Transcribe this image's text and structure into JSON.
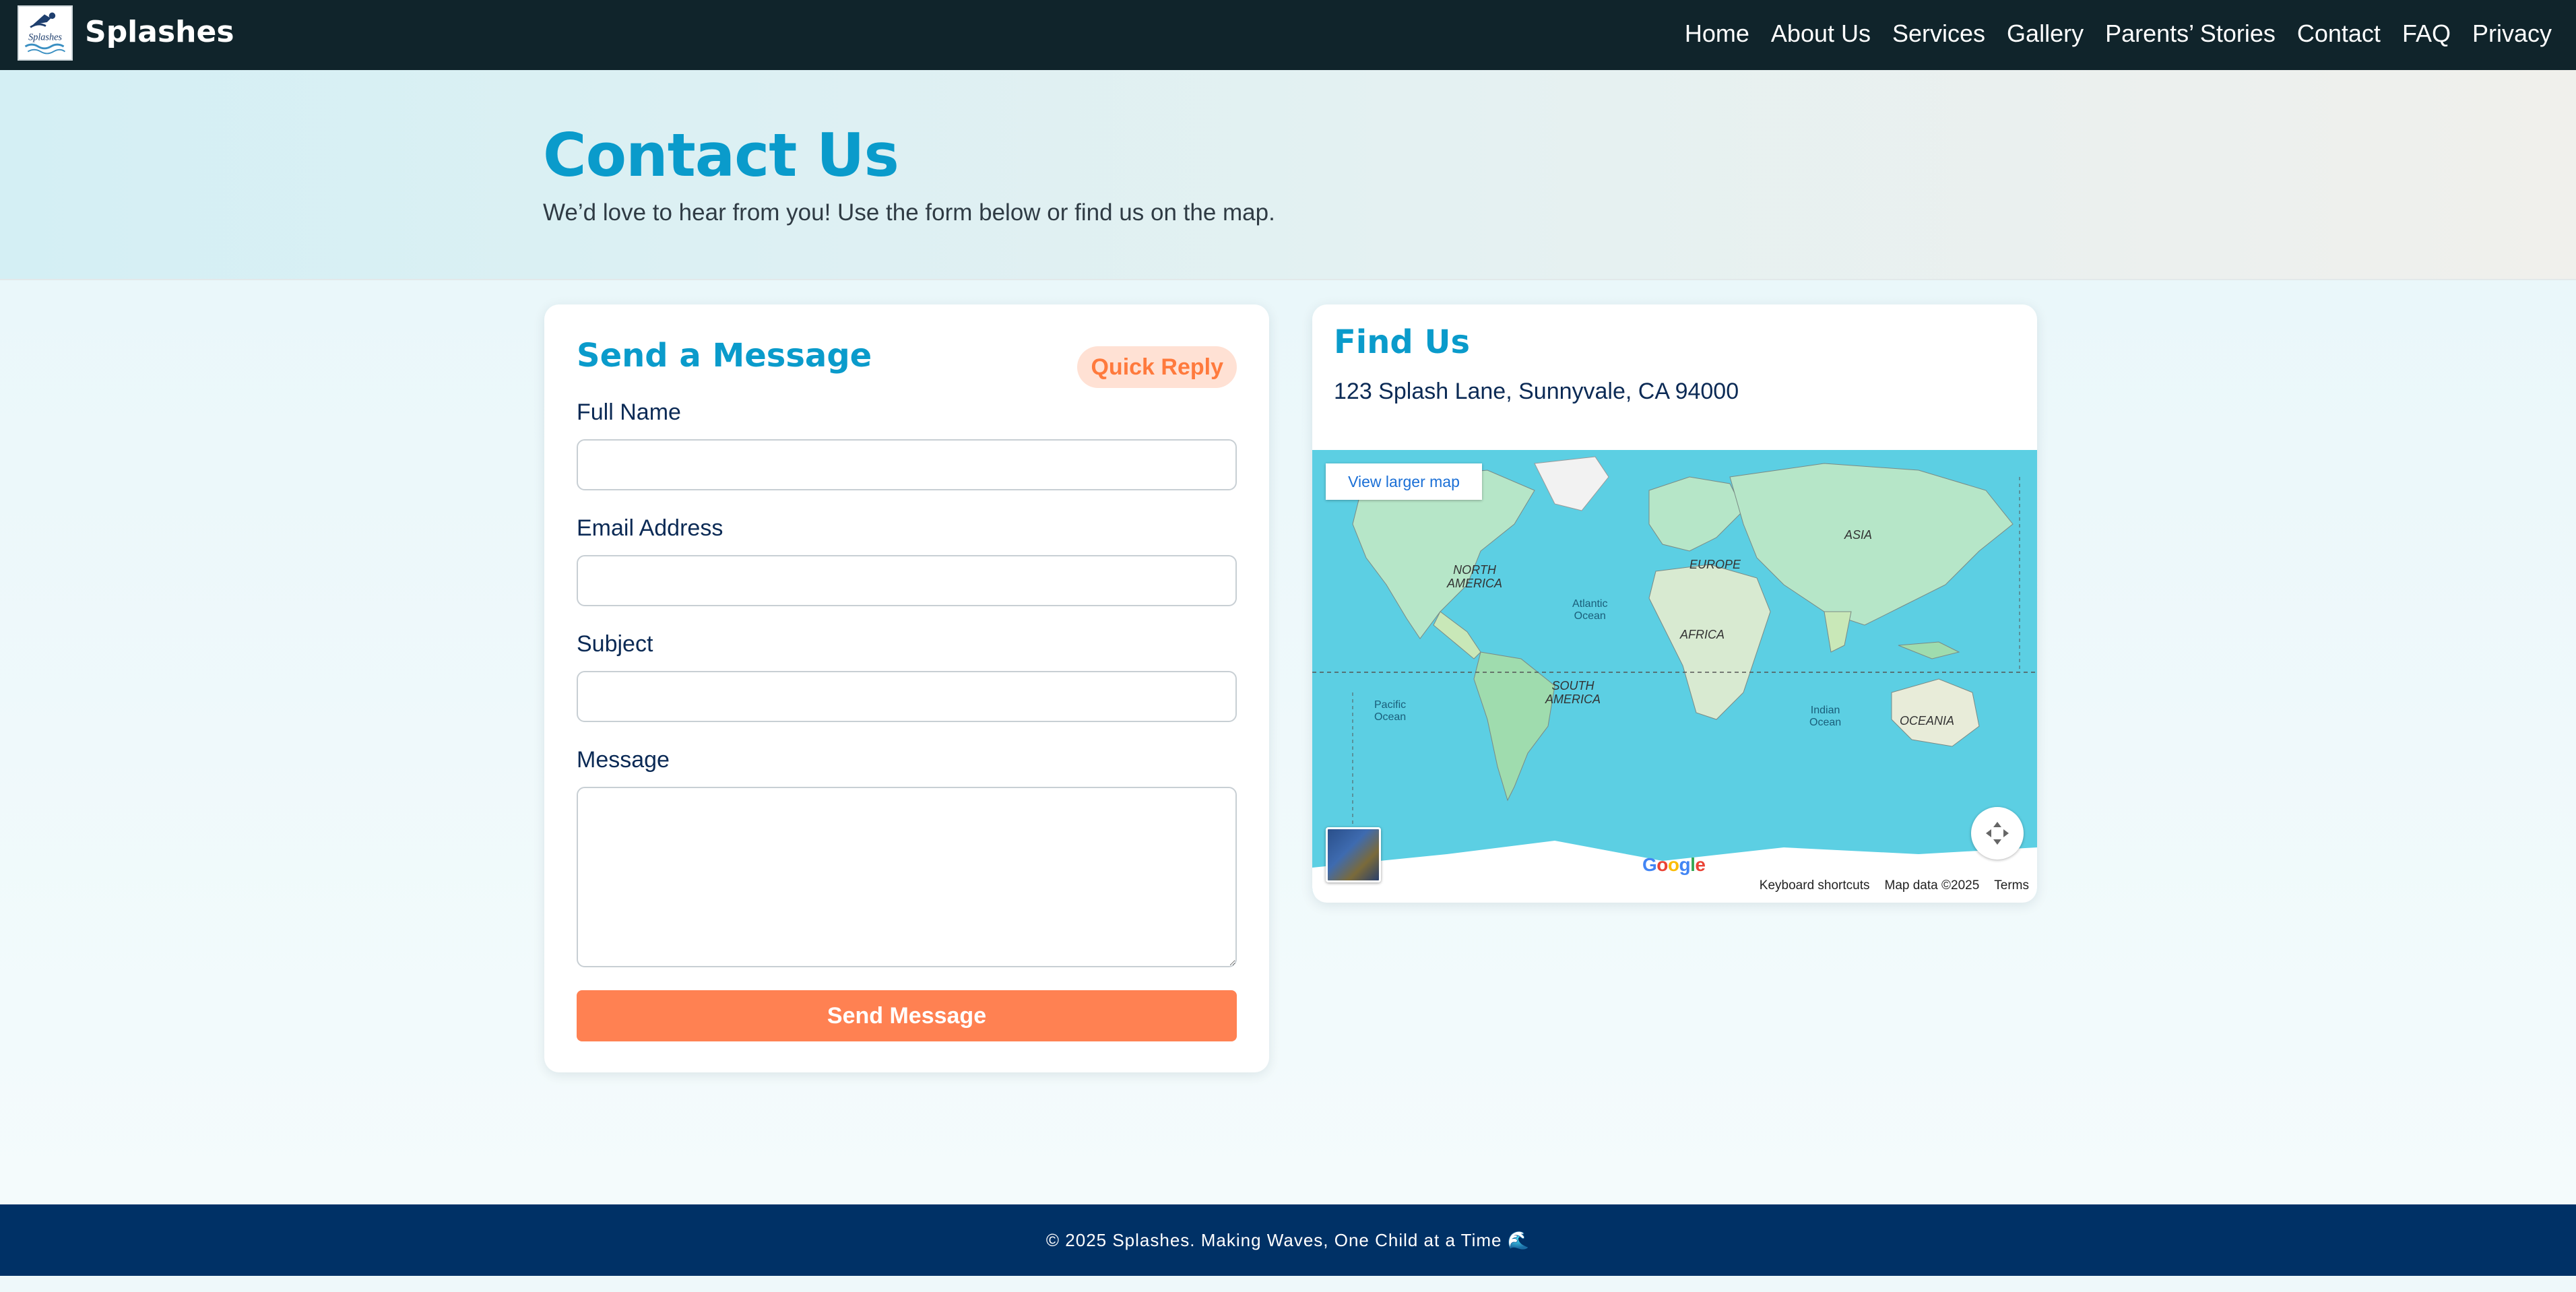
{
  "nav": {
    "brand": "Splashes",
    "logo_text": "Splashes",
    "links": [
      "Home",
      "About Us",
      "Services",
      "Gallery",
      "Parents’ Stories",
      "Contact",
      "FAQ",
      "Privacy"
    ]
  },
  "hero": {
    "title": "Contact Us",
    "subtitle": "We’d love to hear from you! Use the form below or find us on the map."
  },
  "form": {
    "title": "Send a Message",
    "badge": "Quick Reply",
    "fields": {
      "full_name": {
        "label": "Full Name",
        "value": ""
      },
      "email": {
        "label": "Email Address",
        "value": ""
      },
      "subject": {
        "label": "Subject",
        "value": ""
      },
      "message": {
        "label": "Message",
        "value": ""
      }
    },
    "submit_label": "Send Message"
  },
  "map_card": {
    "title": "Find Us",
    "address": "123 Splash Lane, Sunnyvale, CA 94000",
    "view_larger": "View larger map",
    "labels": {
      "north_america": "NORTH\nAMERICA",
      "south_america": "SOUTH\nAMERICA",
      "europe": "EUROPE",
      "asia": "ASIA",
      "africa": "AFRICA",
      "oceania": "OCEANIA",
      "atlantic": "Atlantic\nOcean",
      "pacific": "Pacific\nOcean",
      "indian": "Indian\nOcean"
    },
    "google": "Google",
    "attribution": {
      "shortcuts": "Keyboard shortcuts",
      "map_data": "Map data ©2025",
      "terms": "Terms"
    }
  },
  "footer": {
    "text": "© 2025 Splashes. Making Waves, One Child at a Time 🌊"
  },
  "colors": {
    "accent": "#0a9bcb",
    "cta": "#ff8152",
    "nav_bg": "#10242b",
    "footer_bg": "#003166",
    "ocean": "#5ccfe3",
    "land": "#aee3c3"
  }
}
